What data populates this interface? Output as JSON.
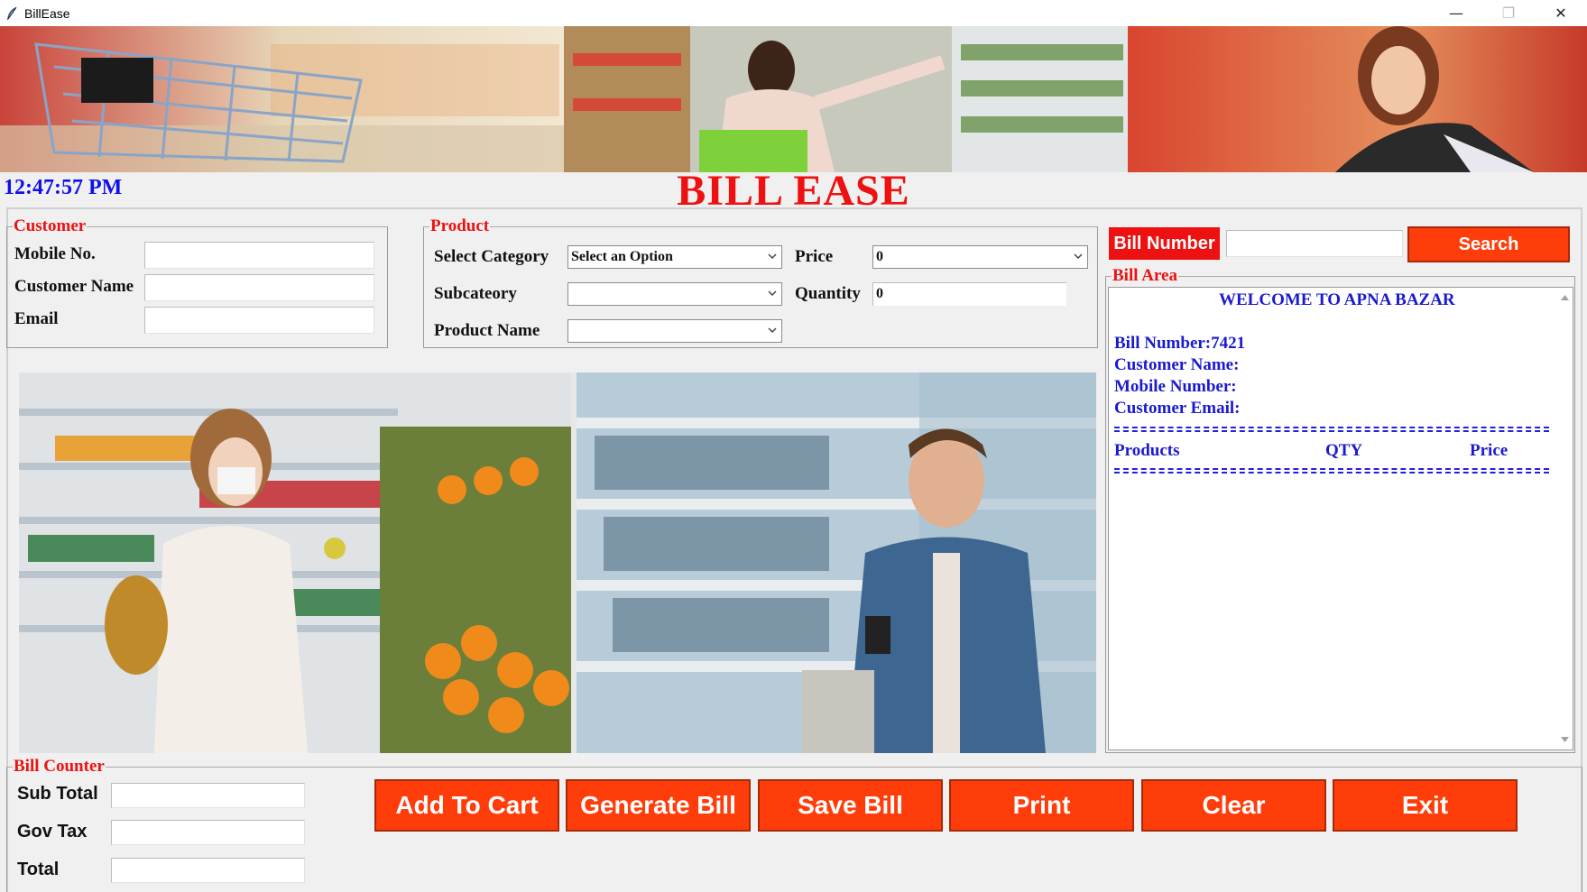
{
  "window": {
    "title": "BillEase",
    "minimize_glyph": "—",
    "maximize_glyph": "❐",
    "close_glyph": "✕"
  },
  "header": {
    "clock": "12:47:57 PM",
    "heading": "BILL EASE"
  },
  "customer": {
    "group_label": "Customer",
    "mobile_label": "Mobile No.",
    "name_label": "Customer Name",
    "email_label": "Email",
    "mobile_value": "",
    "name_value": "",
    "email_value": ""
  },
  "product": {
    "group_label": "Product",
    "category_label": "Select Category",
    "category_value": "Select an Option",
    "subcategory_label": "Subcateory",
    "subcategory_value": "",
    "product_name_label": "Product Name",
    "product_name_value": "",
    "price_label": "Price",
    "price_value": "0",
    "quantity_label": "Quantity",
    "quantity_value": "0"
  },
  "bill": {
    "number_label": "Bill Number",
    "search_value": "",
    "search_button": "Search",
    "area_label": "Bill Area",
    "welcome": "WELCOME TO APNA BAZAR",
    "bill_number_line": "Bill Number:7421",
    "customer_name_line": "Customer Name:",
    "mobile_line": "Mobile Number:",
    "email_line": "Customer Email:",
    "col_products": "Products",
    "col_qty": "QTY",
    "col_price": "Price"
  },
  "counter": {
    "group_label": "Bill Counter",
    "subtotal_label": "Sub Total",
    "tax_label": "Gov Tax",
    "total_label": "Total",
    "subtotal_value": "",
    "tax_value": "",
    "total_value": ""
  },
  "actions": {
    "add_to_cart": "Add To Cart",
    "generate_bill": "Generate Bill",
    "save_bill": "Save Bill",
    "print": "Print",
    "clear": "Clear",
    "exit": "Exit"
  },
  "colors": {
    "accent_red": "#ee1111",
    "button_orange": "#ff3d0a",
    "clock_blue": "#1010ee",
    "bill_text_blue": "#1a1ad0"
  },
  "icons": {
    "app": "feather-icon",
    "dropdown": "chevron-down-icon",
    "scroll_up": "scroll-up-arrow-icon",
    "scroll_down": "scroll-down-arrow-icon"
  }
}
